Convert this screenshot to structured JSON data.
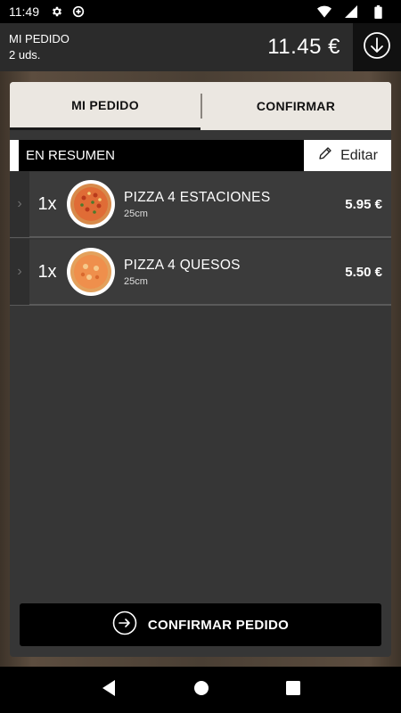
{
  "status_bar": {
    "time": "11:49",
    "icons": [
      "gear-icon",
      "data-saver-icon",
      "wifi-icon",
      "signal-icon",
      "battery-icon"
    ]
  },
  "header": {
    "title": "MI PEDIDO",
    "count": "2 uds.",
    "total": "11.45 €",
    "download_icon": "arrow-down-circle-icon"
  },
  "tabs": [
    {
      "label": "MI PEDIDO",
      "active": true
    },
    {
      "label": "CONFIRMAR",
      "active": false
    }
  ],
  "summary": {
    "label": "EN RESUMEN",
    "edit_label": "Editar",
    "edit_icon": "pencil-icon"
  },
  "items": [
    {
      "qty": "1x",
      "name": "PIZZA 4 ESTACIONES",
      "size": "25cm",
      "price": "5.95 €"
    },
    {
      "qty": "1x",
      "name": "PIZZA 4 QUESOS",
      "size": "25cm",
      "price": "5.50 €"
    }
  ],
  "confirm": {
    "label": "CONFIRMAR PEDIDO",
    "icon": "arrow-right-circle-icon"
  },
  "nav": [
    "back-icon",
    "home-icon",
    "recents-icon"
  ],
  "colors": {
    "panel": "#363636",
    "tab_bg": "#ebe7e1",
    "accent_dark": "#000000"
  }
}
